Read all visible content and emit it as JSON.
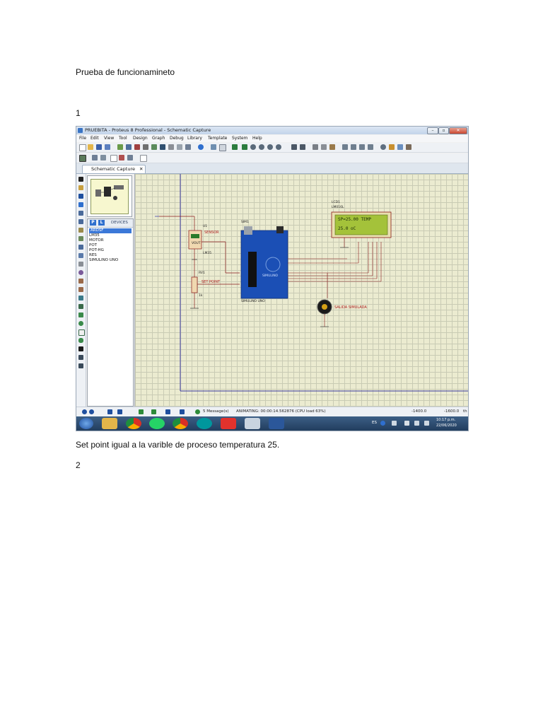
{
  "document": {
    "heading": "Prueba de funcionamineto",
    "step1": "1",
    "caption": "Set point igual a la varible de proceso temperatura 25.",
    "step2": "2"
  },
  "app": {
    "title": "PRUEBITA - Proteus 8 Professional - Schematic Capture",
    "menu": [
      "File",
      "Edit",
      "View",
      "Tool",
      "Design",
      "Graph",
      "Debug",
      "Library",
      "Template",
      "System",
      "Help"
    ],
    "tab_label": "Schematic Capture",
    "tab_close": "✕",
    "devices": {
      "p_button": "P",
      "l_button": "L",
      "header": "DEVICES",
      "items": [
        "ARDSF",
        "LM35",
        "MOTOR",
        "POT",
        "POT-HG",
        "RES",
        "SIMULINO UNO"
      ],
      "selected_index": 0
    },
    "schematic": {
      "u1_label": "U1",
      "sensor_label": "SENSOR",
      "sensor_part": "LM35",
      "sensor_value": "VOUT",
      "rv1_label": "RV1",
      "setpoint_label": "SET POINT",
      "rv1_part": "1k",
      "sim1_label": "SIM1",
      "arduino_part": "SIMULINO UNO",
      "arduino_brand": "SIMULINO",
      "lcd_label": "LCD1",
      "lcd_part": "LM016L",
      "lcd_line1": "SP=25.00 TEMP",
      "lcd_line2": "25.0 oC  ",
      "motor_label": "SALIDA SIMULADA"
    },
    "status": {
      "messages": "5 Message(s)",
      "animating": "ANIMATING: 00:00:14.562876 (CPU load 63%)",
      "coord_x": "-1400.0",
      "coord_y": "-1600.0",
      "unit": "th"
    },
    "taskbar": {
      "lang": "ES",
      "time": "10:17 p.m.",
      "date": "22/06/2020"
    }
  }
}
